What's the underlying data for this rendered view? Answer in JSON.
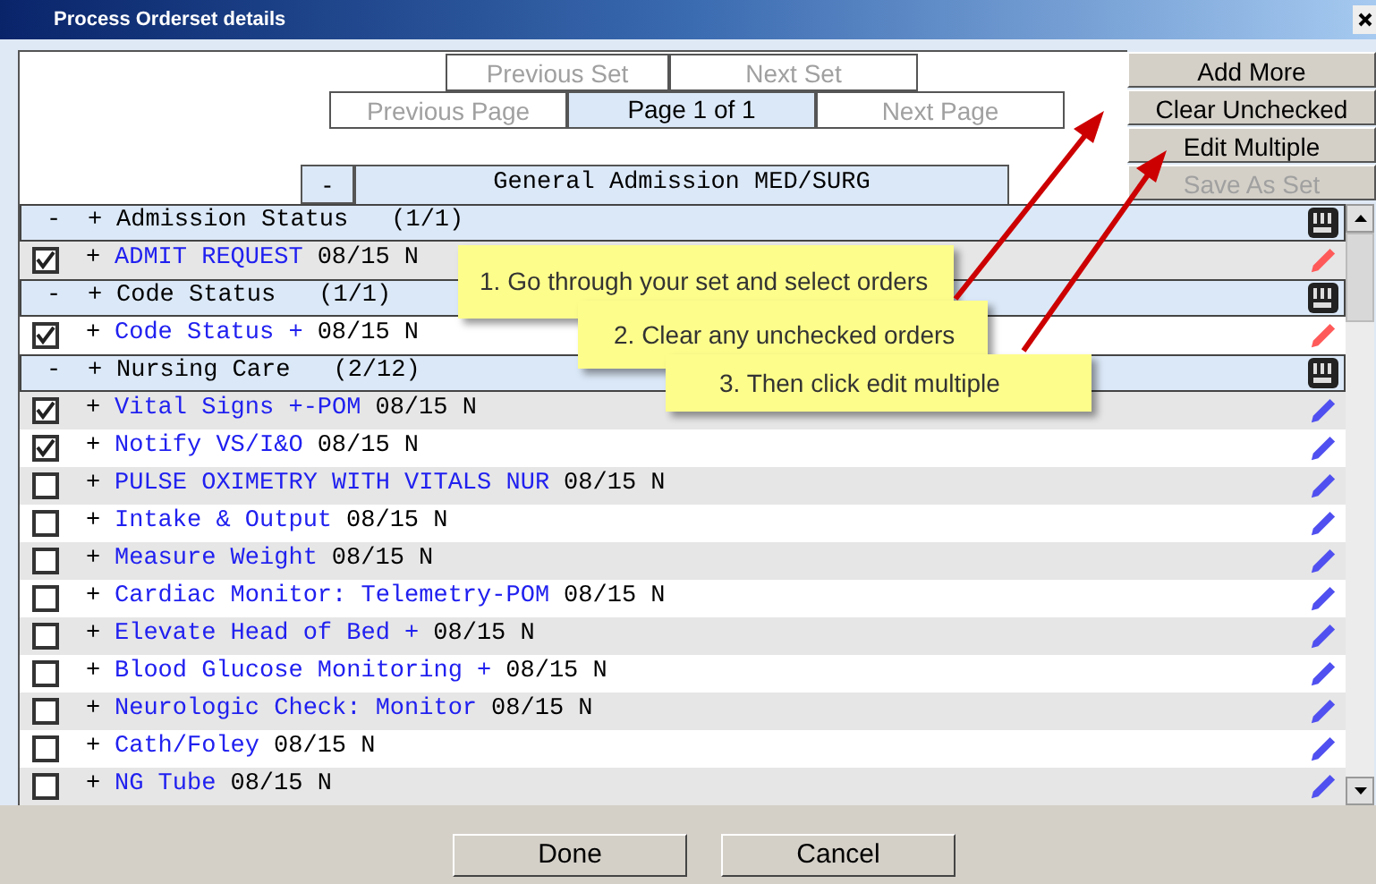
{
  "window": {
    "title": "Process Orderset details"
  },
  "nav": {
    "previous_set": {
      "label": "Previous Set",
      "disabled": true
    },
    "next_set": {
      "label": "Next Set",
      "disabled": true
    },
    "previous_page": {
      "label": "Previous Page",
      "disabled": true
    },
    "page": "Page 1 of 1",
    "next_page": {
      "label": "Next Page",
      "disabled": true
    }
  },
  "set_header": {
    "collapse": "-",
    "title": "General Admission MED/SURG"
  },
  "side_buttons": [
    {
      "label": "Add More",
      "disabled": false
    },
    {
      "label": "Clear Unchecked",
      "disabled": false
    },
    {
      "label": "Edit Multiple",
      "disabled": false
    },
    {
      "label": "Save As Set",
      "disabled": true
    }
  ],
  "rows": [
    {
      "kind": "group",
      "collapse": "-",
      "expand": "+",
      "label": "Admission Status",
      "count": "(1/1)"
    },
    {
      "kind": "order",
      "checked": true,
      "expand": "+",
      "name": "ADMIT REQUEST",
      "detail": "08/15 N",
      "color": "#ff5a5a"
    },
    {
      "kind": "group",
      "collapse": "-",
      "expand": "+",
      "label": "Code Status",
      "count": "(1/1)"
    },
    {
      "kind": "order",
      "checked": true,
      "expand": "+",
      "name": "Code Status +",
      "detail": "08/15 N",
      "color": "#ff5a5a"
    },
    {
      "kind": "group",
      "collapse": "-",
      "expand": "+",
      "label": "Nursing Care",
      "count": "(2/12)"
    },
    {
      "kind": "order",
      "checked": true,
      "expand": "+",
      "name": "Vital Signs +-POM",
      "detail": "08/15 N",
      "color": "#5050f0"
    },
    {
      "kind": "order",
      "checked": true,
      "expand": "+",
      "name": "Notify VS/I&O",
      "detail": "08/15 N",
      "color": "#5050f0"
    },
    {
      "kind": "order",
      "checked": false,
      "expand": "+",
      "name": "PULSE OXIMETRY WITH VITALS NUR",
      "detail": "08/15 N",
      "color": "#5050f0"
    },
    {
      "kind": "order",
      "checked": false,
      "expand": "+",
      "name": "Intake & Output",
      "detail": "08/15 N",
      "color": "#5050f0"
    },
    {
      "kind": "order",
      "checked": false,
      "expand": "+",
      "name": "Measure Weight",
      "detail": "08/15 N",
      "color": "#5050f0"
    },
    {
      "kind": "order",
      "checked": false,
      "expand": "+",
      "name": "Cardiac Monitor: Telemetry-POM",
      "detail": "08/15 N",
      "color": "#5050f0"
    },
    {
      "kind": "order",
      "checked": false,
      "expand": "+",
      "name": "Elevate Head of Bed +",
      "detail": "08/15 N",
      "color": "#5050f0"
    },
    {
      "kind": "order",
      "checked": false,
      "expand": "+",
      "name": "Blood Glucose Monitoring +",
      "detail": "08/15 N",
      "color": "#5050f0"
    },
    {
      "kind": "order",
      "checked": false,
      "expand": "+",
      "name": "Neurologic Check: Monitor",
      "detail": "08/15 N",
      "color": "#5050f0"
    },
    {
      "kind": "order",
      "checked": false,
      "expand": "+",
      "name": "Cath/Foley",
      "detail": "08/15 N",
      "color": "#5050f0"
    },
    {
      "kind": "order",
      "checked": false,
      "expand": "+",
      "name": "NG Tube",
      "detail": "08/15 N",
      "color": "#5050f0"
    }
  ],
  "callouts": [
    {
      "text": "1. Go through your set and select orders"
    },
    {
      "text": "2. Clear any unchecked orders"
    },
    {
      "text": "3. Then click edit multiple"
    }
  ],
  "footer_buttons": [
    {
      "label": "Done"
    },
    {
      "label": "Cancel"
    }
  ]
}
